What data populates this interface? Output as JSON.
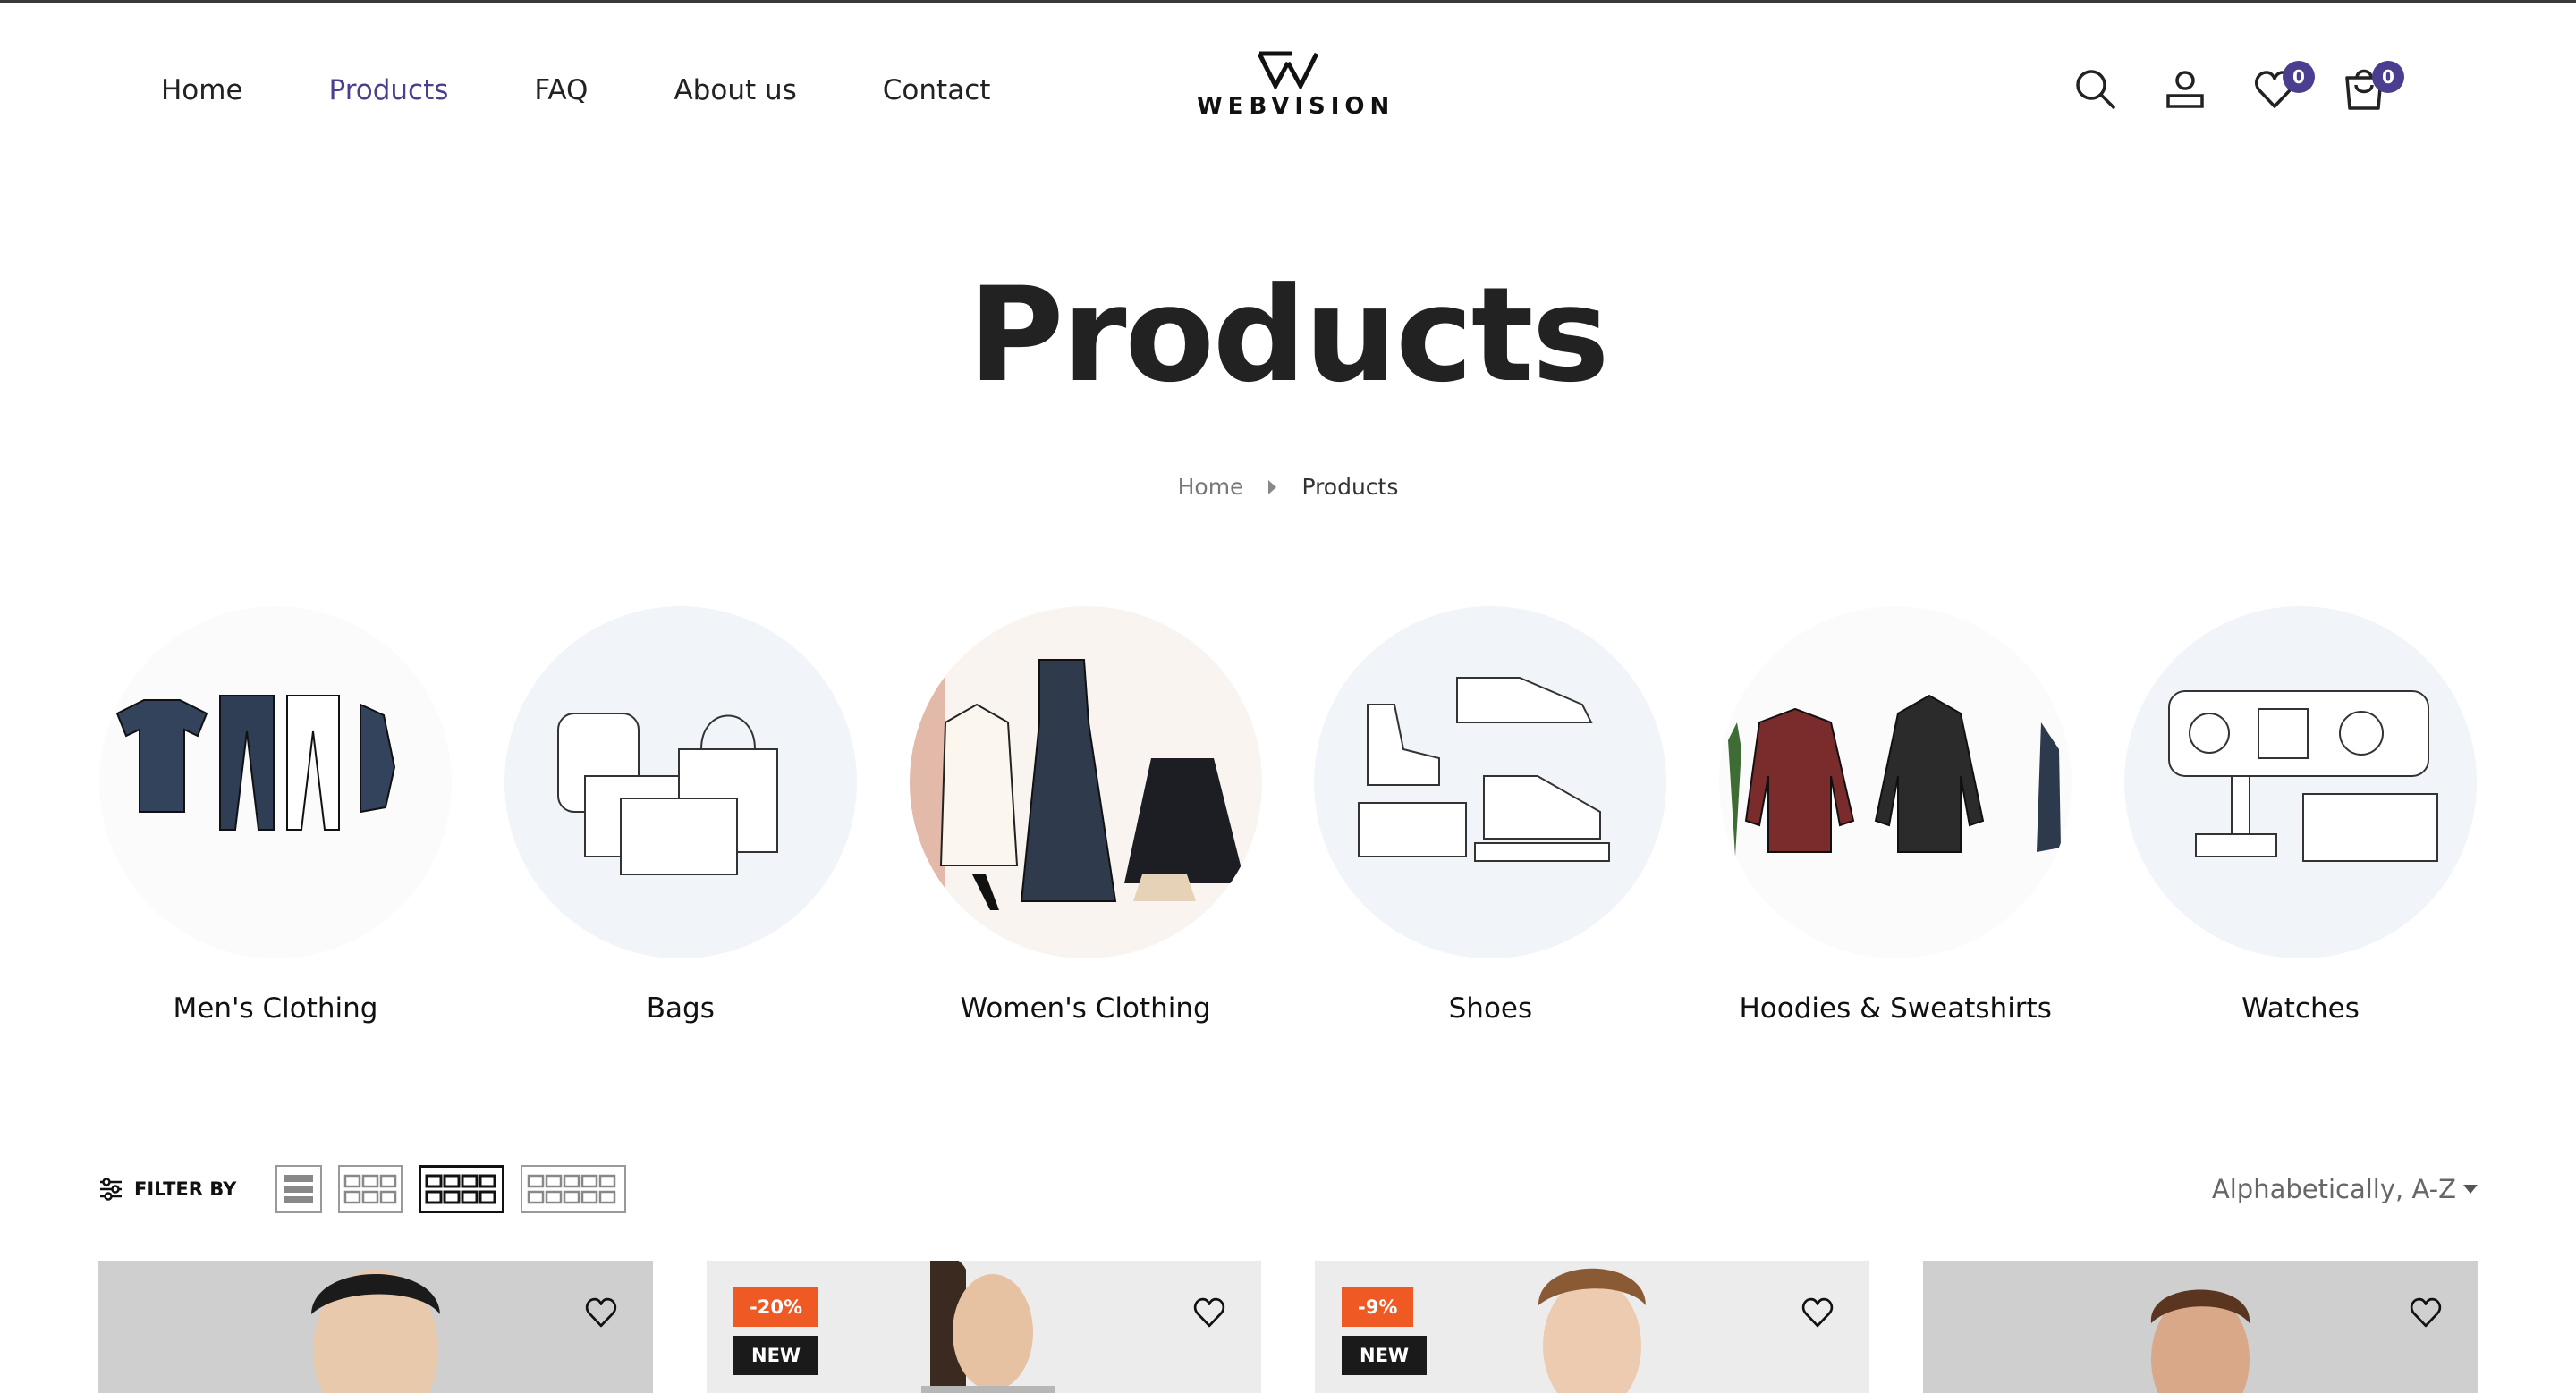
{
  "nav": {
    "items": [
      {
        "label": "Home",
        "active": false
      },
      {
        "label": "Products",
        "active": true
      },
      {
        "label": "FAQ",
        "active": false
      },
      {
        "label": "About us",
        "active": false
      },
      {
        "label": "Contact",
        "active": false
      }
    ]
  },
  "brand": {
    "name": "WEBVISION",
    "accent": "#4b3d8f"
  },
  "header_icons": {
    "search": "search-icon",
    "account": "account-icon",
    "wishlist": "heart-icon",
    "wishlist_count": "0",
    "cart": "cart-icon",
    "cart_count": "0"
  },
  "page": {
    "title": "Products"
  },
  "breadcrumb": {
    "home": "Home",
    "current": "Products"
  },
  "categories": [
    {
      "label": "Men's Clothing"
    },
    {
      "label": "Bags"
    },
    {
      "label": "Women's Clothing"
    },
    {
      "label": "Shoes"
    },
    {
      "label": "Hoodies & Sweatshirts"
    },
    {
      "label": "Watches"
    }
  ],
  "toolbar": {
    "filter_label": "FILTER BY",
    "views": [
      "list-view",
      "grid-3-view",
      "grid-4-view",
      "grid-5-view"
    ],
    "active_view": "grid-4-view",
    "sort_label": "Alphabetically, A-Z"
  },
  "products": [
    {
      "sale": "",
      "new": ""
    },
    {
      "sale": "-20%",
      "new": "NEW"
    },
    {
      "sale": "-9%",
      "new": "NEW"
    },
    {
      "sale": "",
      "new": ""
    }
  ],
  "colors": {
    "sale_tag": "#ef5a24",
    "new_tag": "#1a1a1a",
    "badge": "#4b3d8f"
  }
}
